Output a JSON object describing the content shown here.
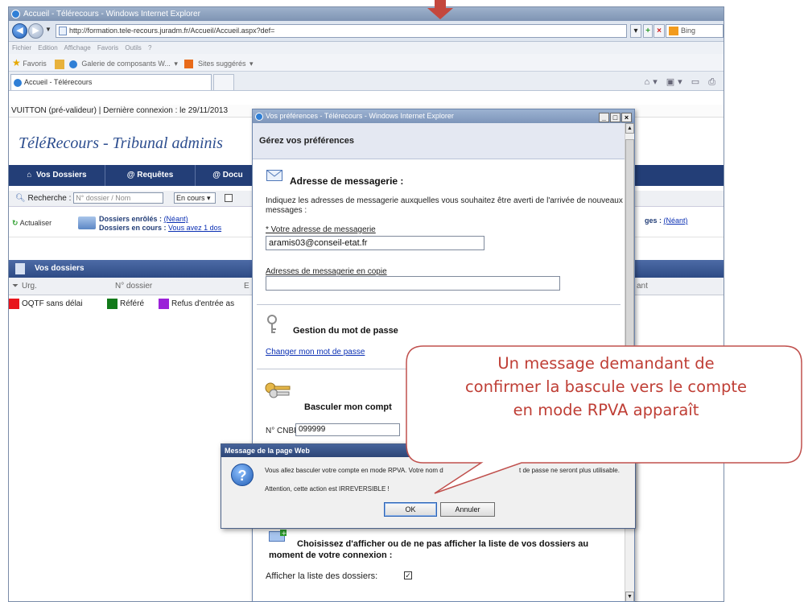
{
  "browser": {
    "title": "Accueil - Télérecours - Windows Internet Explorer",
    "url": "http://formation.tele-recours.juradm.fr/Accueil/Accueil.aspx?def=",
    "search_engine": "Bing",
    "menu": "Fichier   Edition   Affichage   Favoris   Outils   ?",
    "favorites_label": "Favoris",
    "favbar_item1": "Galerie de composants W...",
    "favbar_item2": "Sites suggérés",
    "tab_label": "Accueil - Télérecours"
  },
  "page": {
    "user_line": "VUITTON (pré-valideur) | Dernière connexion : le 29/11/2013",
    "site_title": "TéléRecours - Tribunal adminis",
    "nav": {
      "item1": "Vos Dossiers",
      "item2": "@ Requêtes",
      "item3": "@ Docu"
    },
    "search": {
      "label": "Recherche :",
      "placeholder": "N° dossier / Nom",
      "status": "En cours"
    },
    "refresh_label": "Actualiser",
    "enrolled_label": "Dossiers enrôlés :",
    "enrolled_value": "(Néant)",
    "in_progress_label": "Dossiers en cours :",
    "in_progress_value": "Vous avez 1 dos",
    "pages_label": "ges :",
    "pages_value": "(Néant)",
    "dossiers_header": "Vos dossiers",
    "columns": {
      "c1": "Urg.",
      "c2": "N° dossier",
      "c3": "E",
      "c4": "ant"
    },
    "legend": [
      {
        "label": "OQTF sans délai",
        "color": "#e8141b"
      },
      {
        "label": "Référé",
        "color": "#127a1a"
      },
      {
        "label": "Refus d'entrée as",
        "color": "#9b22d8"
      }
    ]
  },
  "prefs": {
    "window_title": "Vos préférences - Télérecours - Windows Internet Explorer",
    "heading": "Gérez vos préférences",
    "email_section": "Adresse de messagerie :",
    "email_intro": "Indiquez les adresses de messagerie auxquelles vous souhaitez être averti de l'arrivée de nouveaux messages :",
    "email_label": "* Votre adresse de messagerie",
    "email_value": "aramis03@conseil-etat.fr",
    "cc_label": "Adresses de messagerie en copie",
    "cc_value": "",
    "password_section": "Gestion du mot de passe",
    "password_link": "Changer mon mot de passe",
    "switch_section": "Basculer mon compt",
    "cnbf_label": "N° CNBF",
    "cnbf_value": "099999",
    "list_section": "Choisissez d'afficher ou de ne pas afficher la liste de vos dossiers au moment de votre connexion :",
    "list_checkbox_label": "Afficher la liste des dossiers:"
  },
  "msgbox": {
    "title": "Message de la page Web",
    "line1_a": "Vous allez basculer votre compte en mode RPVA. Votre nom d",
    "line1_b": "t de passe ne seront plus utilisable.",
    "line2": "Attention, cette action est IRREVERSIBLE !",
    "ok": "OK",
    "cancel": "Annuler"
  },
  "callout": {
    "line1": "Un message demandant de",
    "line2": "confirmer la bascule vers le compte",
    "line3": "en mode RPVA apparaît"
  },
  "colors": {
    "callout_text": "#bf3e35",
    "arrow": "#c4473d",
    "nav": "#233e77"
  }
}
